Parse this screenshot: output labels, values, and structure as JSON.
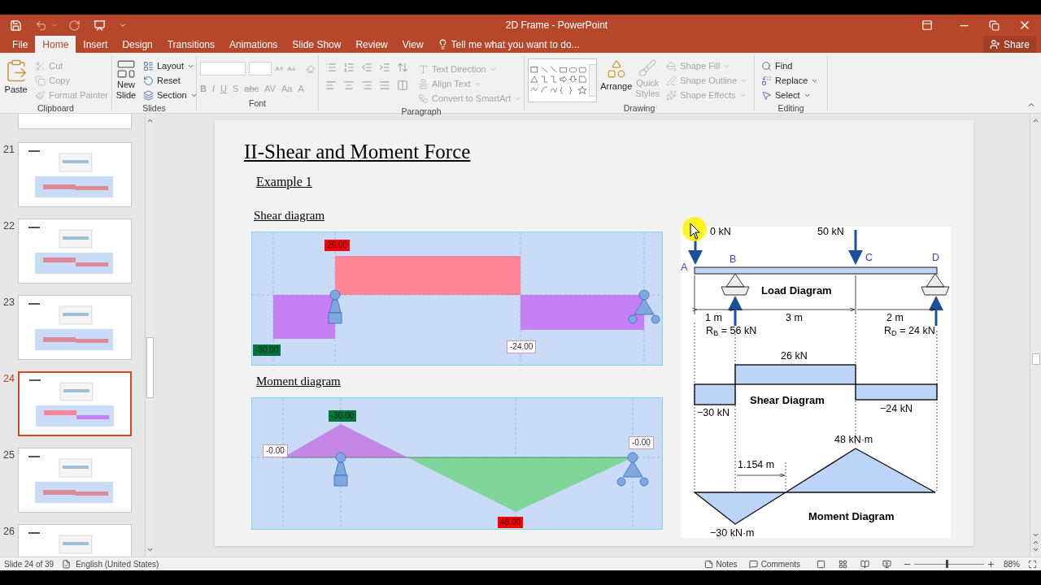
{
  "window": {
    "title": "2D Frame - PowerPoint"
  },
  "ribbon_tabs": [
    {
      "label": "File",
      "selected": false
    },
    {
      "label": "Home",
      "selected": true
    },
    {
      "label": "Insert",
      "selected": false
    },
    {
      "label": "Design",
      "selected": false
    },
    {
      "label": "Transitions",
      "selected": false
    },
    {
      "label": "Animations",
      "selected": false
    },
    {
      "label": "Slide Show",
      "selected": false
    },
    {
      "label": "Review",
      "selected": false
    },
    {
      "label": "View",
      "selected": false
    }
  ],
  "tell_me": {
    "placeholder": "Tell me what you want to do..."
  },
  "share": "Share",
  "ribbon_groups": [
    {
      "kind": "clipboard",
      "label": "Clipboard",
      "items": [
        {
          "label": "Paste",
          "disabled": false
        },
        {
          "label": "Cut",
          "disabled": true
        },
        {
          "label": "Copy",
          "disabled": true
        },
        {
          "label": "Format Painter",
          "disabled": true
        }
      ]
    },
    {
      "kind": "slides",
      "label": "Slides",
      "items": [
        {
          "label": "New Slide",
          "disabled": false
        },
        {
          "label": "Layout",
          "disabled": false
        },
        {
          "label": "Reset",
          "disabled": false
        },
        {
          "label": "Section",
          "disabled": false
        }
      ]
    },
    {
      "kind": "font",
      "label": "Font",
      "items": [
        {
          "label": "B",
          "disabled": true
        },
        {
          "label": "I",
          "disabled": true
        },
        {
          "label": "U",
          "disabled": true
        },
        {
          "label": "S",
          "disabled": true
        },
        {
          "label": "abc",
          "disabled": true
        },
        {
          "label": "AV",
          "disabled": true
        },
        {
          "label": "Aa",
          "disabled": true
        },
        {
          "label": "A",
          "disabled": true
        }
      ]
    },
    {
      "kind": "paragraph",
      "label": "Paragraph",
      "items": [
        {
          "label": "Text Direction",
          "disabled": true
        },
        {
          "label": "Align Text",
          "disabled": true
        },
        {
          "label": "Convert to SmartArt",
          "disabled": true
        }
      ]
    },
    {
      "kind": "drawing",
      "label": "Drawing",
      "items": [
        {
          "label": "Arrange",
          "disabled": false
        },
        {
          "label": "Quick Styles",
          "disabled": true
        },
        {
          "label": "Shape Fill",
          "disabled": true
        },
        {
          "label": "Shape Outline",
          "disabled": true
        },
        {
          "label": "Shape Effects",
          "disabled": true
        }
      ]
    },
    {
      "kind": "editing",
      "label": "Editing",
      "items": [
        {
          "label": "Find",
          "disabled": false
        },
        {
          "label": "Replace",
          "disabled": false
        },
        {
          "label": "Select",
          "disabled": false
        }
      ]
    }
  ],
  "thumbnails": [
    {
      "number": "21",
      "selected": false
    },
    {
      "number": "22",
      "selected": false
    },
    {
      "number": "23",
      "selected": false
    },
    {
      "number": "24",
      "selected": true
    },
    {
      "number": "25",
      "selected": false
    },
    {
      "number": "26",
      "selected": false
    }
  ],
  "slide": {
    "title": "II-Shear and Moment Force",
    "subtitle": "Example 1",
    "shear": {
      "heading": "Shear diagram",
      "labels": [
        {
          "text": "26.00",
          "color": "#ff0000"
        },
        {
          "text": "-30.00",
          "color": "#00763a"
        },
        {
          "text": "-24.00",
          "color": "#ffffff"
        }
      ]
    },
    "moment": {
      "heading": "Moment diagram",
      "labels": [
        {
          "text": "-30.00",
          "color": "#00763a"
        },
        {
          "text": "-0.00",
          "color": "#ffffff"
        },
        {
          "text": "-0.00",
          "color": "#ffffff"
        },
        {
          "text": "48.00",
          "color": "#ff0000"
        }
      ]
    },
    "figure": {
      "loads": [
        "0 kN",
        "50 kN"
      ],
      "points": [
        "A",
        "B",
        "C",
        "D"
      ],
      "load_title": "Load Diagram",
      "spans": [
        "1 m",
        "3 m",
        "2 m"
      ],
      "reactions": [
        "R$_{B}$ = 56 kN",
        "R$_{D}$ = 24 kN"
      ],
      "shear_values": [
        "26 kN",
        "−30 kN",
        "−24 kN"
      ],
      "shear_title": "Shear Diagram",
      "moment_values": [
        "48 kN·m",
        "−30 kN·m"
      ],
      "distance": "1.154 m",
      "moment_title": "Moment Diagram"
    }
  },
  "status_bar": {
    "slide": "Slide 24 of 39",
    "language": "English (United States)",
    "notes": "Notes",
    "comments": "Comments",
    "zoom": {
      "level": 0.47,
      "reading": "88%"
    }
  }
}
